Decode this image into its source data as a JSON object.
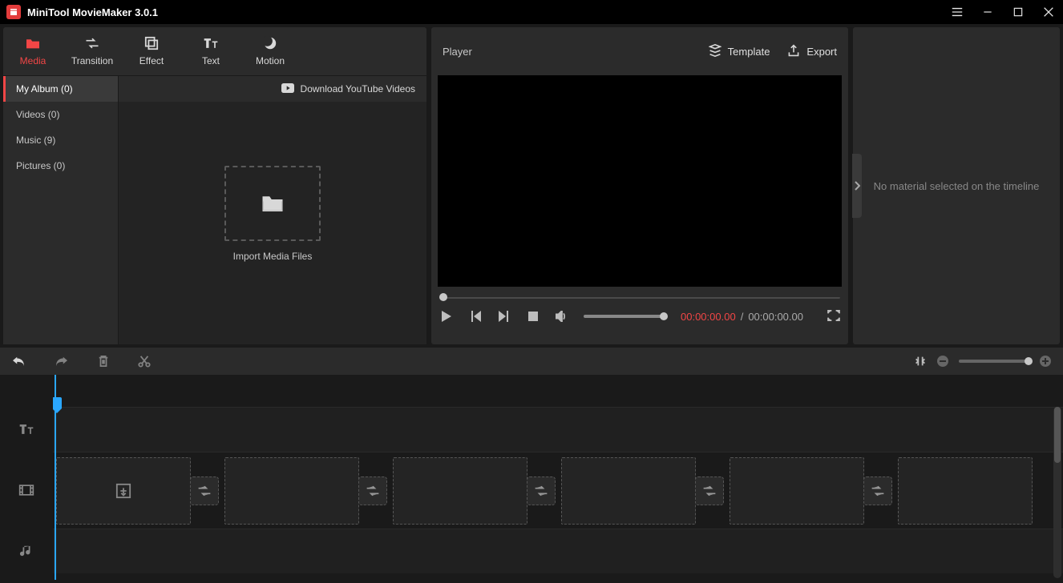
{
  "app": {
    "title": "MiniTool MovieMaker 3.0.1"
  },
  "tabs": {
    "media": "Media",
    "transition": "Transition",
    "effect": "Effect",
    "text": "Text",
    "motion": "Motion"
  },
  "media": {
    "download": "Download YouTube Videos",
    "import": "Import Media Files",
    "categories": {
      "album": "My Album (0)",
      "videos": "Videos (0)",
      "music": "Music (9)",
      "pictures": "Pictures (0)"
    }
  },
  "player": {
    "label": "Player",
    "template": "Template",
    "export": "Export",
    "current": "00:00:00.00",
    "sep": "/",
    "total": "00:00:00.00"
  },
  "props": {
    "empty": "No material selected on the timeline"
  }
}
